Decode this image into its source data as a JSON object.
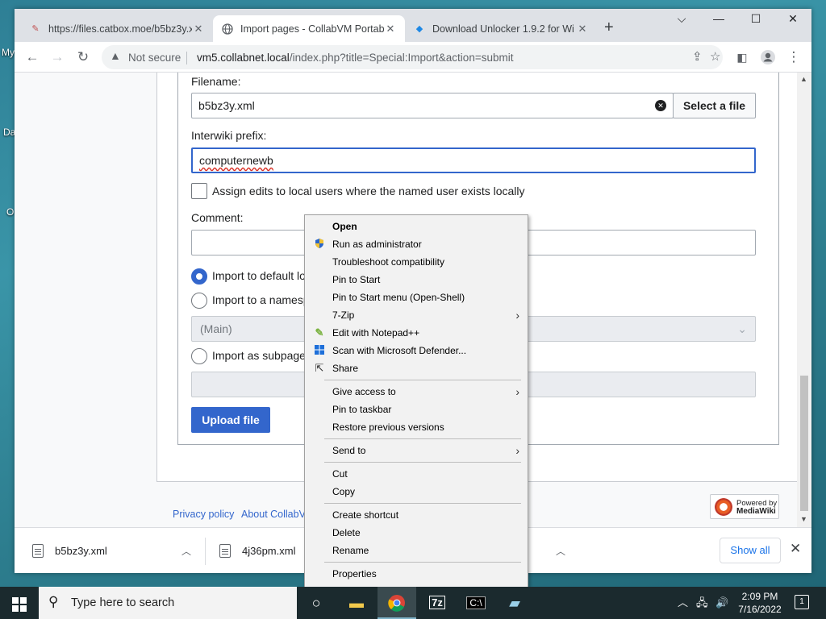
{
  "desktop": {
    "fragments": [
      "My",
      "Da",
      "O"
    ]
  },
  "browser": {
    "tabs": [
      {
        "title": "https://files.catbox.moe/b5bz3y.x",
        "active": false
      },
      {
        "title": "Import pages - CollabVM Portab",
        "active": true
      },
      {
        "title": "Download Unlocker 1.9.2 for Wi",
        "active": false
      }
    ],
    "new_tab_label": "+",
    "window_controls": {
      "minimize": "⌵",
      "restore": "—",
      "maximize": "☐",
      "close": "✕"
    },
    "toolbar": {
      "security_label": "Not secure",
      "url_host": "vm5.collabnet.local",
      "url_path": "/index.php?title=Special:Import&action=submit"
    }
  },
  "page": {
    "filename_label": "Filename:",
    "filename_value": "b5bz3y.xml",
    "select_file_button": "Select a file",
    "interwiki_label": "Interwiki prefix:",
    "interwiki_value": "computernewb",
    "assign_edits_label": "Assign edits to local users where the named user exists locally",
    "comment_label": "Comment:",
    "comment_value": "",
    "radio_default": "Import to default lo",
    "radio_namespace": "Import to a namesp",
    "namespace_select": "(Main)",
    "radio_subpage": "Import as subpage",
    "upload_button": "Upload file",
    "footer": {
      "privacy": "Privacy policy",
      "about": "About CollabV",
      "powered_line1": "Powered by",
      "powered_line2": "MediaWiki"
    }
  },
  "downloads": {
    "items": [
      "b5bz3y.xml",
      "4j36pm.xml"
    ],
    "show_all": "Show all"
  },
  "context_menu": {
    "items": [
      {
        "label": "Open",
        "bold": true,
        "icon": "",
        "submenu": false
      },
      {
        "label": "Run as administrator",
        "icon": "shield-icon",
        "submenu": false
      },
      {
        "label": "Troubleshoot compatibility",
        "icon": "",
        "submenu": false
      },
      {
        "label": "Pin to Start",
        "icon": "",
        "submenu": false
      },
      {
        "label": "Pin to Start menu (Open-Shell)",
        "icon": "",
        "submenu": false
      },
      {
        "label": "7-Zip",
        "icon": "",
        "submenu": true
      },
      {
        "label": "Edit with Notepad++",
        "icon": "notepadpp-icon",
        "submenu": false
      },
      {
        "label": "Scan with Microsoft Defender...",
        "icon": "defender-icon",
        "submenu": false
      },
      {
        "label": "Share",
        "icon": "share-icon",
        "submenu": false
      },
      {
        "label": "Give access to",
        "icon": "",
        "submenu": true
      },
      {
        "label": "Pin to taskbar",
        "icon": "",
        "submenu": false
      },
      {
        "label": "Restore previous versions",
        "icon": "",
        "submenu": false
      },
      {
        "label": "Send to",
        "icon": "",
        "submenu": true
      },
      {
        "label": "Cut",
        "icon": "",
        "submenu": false
      },
      {
        "label": "Copy",
        "icon": "",
        "submenu": false
      },
      {
        "label": "Create shortcut",
        "icon": "",
        "submenu": false
      },
      {
        "label": "Delete",
        "icon": "",
        "submenu": false
      },
      {
        "label": "Rename",
        "icon": "",
        "submenu": false
      },
      {
        "label": "Properties",
        "icon": "",
        "submenu": false
      }
    ]
  },
  "taskbar": {
    "search_placeholder": "Type here to search",
    "clock_time": "2:09 PM",
    "clock_date": "7/16/2022",
    "notification_count": "1",
    "apps": [
      "task-view-icon",
      "file-explorer-icon",
      "chrome-icon",
      "7zip-icon",
      "terminal-icon",
      "notepad-icon"
    ]
  },
  "colors": {
    "accent": "#3366cc",
    "taskbar": "#1b2a2e",
    "chrome_tabstrip": "#dee1e6"
  }
}
